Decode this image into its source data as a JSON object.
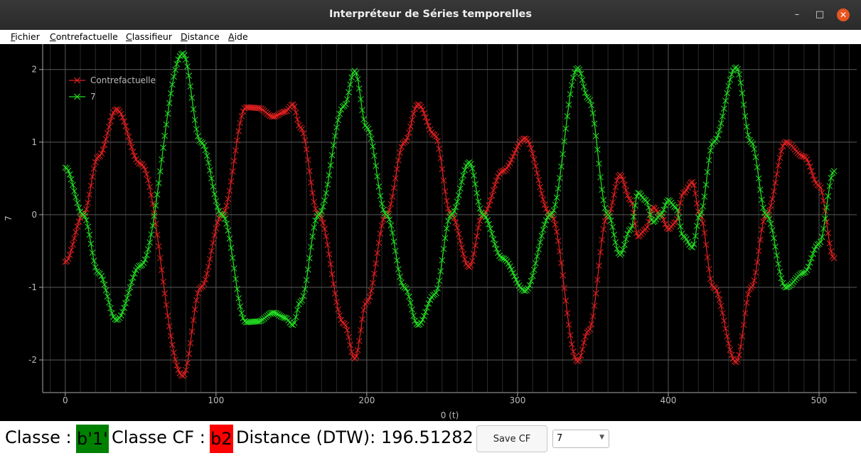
{
  "window": {
    "title": "Interpréteur de Séries temporelles"
  },
  "menu": [
    {
      "first": "F",
      "rest": "ichier"
    },
    {
      "first": "C",
      "rest": "ontrefactuelle"
    },
    {
      "first": "C",
      "rest": "lassifieur"
    },
    {
      "first": "D",
      "rest": "istance"
    },
    {
      "first": "A",
      "rest": "ide"
    }
  ],
  "status": {
    "classe_label": "Classe :",
    "classe_value": "b'1'",
    "classe_color": "#008000",
    "classe_cf_label": "Classe CF :",
    "classe_cf_value": "b2",
    "classe_cf_color": "#ff0000",
    "distance_label": "Distance (DTW):",
    "distance_value": "196.51282",
    "save_label": "Save CF",
    "series_select": "7"
  },
  "chart_data": {
    "type": "line",
    "xlabel": "0 (t)",
    "ylabel": "7",
    "xlim": [
      -15,
      525
    ],
    "ylim": [
      -2.45,
      2.35
    ],
    "x_ticks": [
      0,
      100,
      200,
      300,
      400,
      500
    ],
    "y_ticks": [
      2,
      1,
      0,
      -1,
      -2
    ],
    "y_tick_labels": [
      "2",
      "1",
      "0",
      "-1",
      "-2"
    ],
    "grid": true,
    "legend_position": "top-left",
    "marker": "x",
    "series": [
      {
        "name": "Contrefactuelle",
        "color": "#e02020",
        "points": [
          [
            0,
            -0.65
          ],
          [
            12,
            0
          ],
          [
            22,
            0.8
          ],
          [
            34,
            1.45
          ],
          [
            50,
            0.7
          ],
          [
            78,
            -2.22
          ],
          [
            90,
            -1.0
          ],
          [
            104,
            0
          ],
          [
            120,
            1.48
          ],
          [
            128,
            1.47
          ],
          [
            138,
            1.35
          ],
          [
            146,
            1.42
          ],
          [
            151,
            1.52
          ],
          [
            156,
            1.2
          ],
          [
            168,
            0
          ],
          [
            185,
            -1.5
          ],
          [
            192,
            -1.98
          ],
          [
            200,
            -1.2
          ],
          [
            213,
            0
          ],
          [
            225,
            1.0
          ],
          [
            234,
            1.52
          ],
          [
            245,
            1.1
          ],
          [
            256,
            0
          ],
          [
            268,
            -0.72
          ],
          [
            277,
            0
          ],
          [
            290,
            0.6
          ],
          [
            305,
            1.05
          ],
          [
            322,
            0
          ],
          [
            340,
            -2.02
          ],
          [
            347,
            -1.6
          ],
          [
            360,
            0
          ],
          [
            368,
            0.55
          ],
          [
            375,
            0.2
          ],
          [
            380,
            -0.3
          ],
          [
            385,
            -0.2
          ],
          [
            390,
            0.1
          ],
          [
            395,
            0.0
          ],
          [
            400,
            -0.2
          ],
          [
            405,
            -0.1
          ],
          [
            410,
            0.3
          ],
          [
            416,
            0.45
          ],
          [
            421,
            0.0
          ],
          [
            430,
            -1.0
          ],
          [
            445,
            -2.03
          ],
          [
            455,
            -1.0
          ],
          [
            465,
            0
          ],
          [
            478,
            1.0
          ],
          [
            490,
            0.8
          ],
          [
            500,
            0.4
          ],
          [
            510,
            -0.6
          ]
        ]
      },
      {
        "name": "7",
        "color": "#22dd22",
        "points": [
          [
            0,
            0.65
          ],
          [
            12,
            0
          ],
          [
            22,
            -0.8
          ],
          [
            34,
            -1.45
          ],
          [
            50,
            -0.7
          ],
          [
            78,
            2.22
          ],
          [
            90,
            1.0
          ],
          [
            104,
            0
          ],
          [
            120,
            -1.48
          ],
          [
            128,
            -1.47
          ],
          [
            138,
            -1.35
          ],
          [
            146,
            -1.42
          ],
          [
            151,
            -1.52
          ],
          [
            156,
            -1.2
          ],
          [
            168,
            0
          ],
          [
            185,
            1.5
          ],
          [
            192,
            1.98
          ],
          [
            200,
            1.2
          ],
          [
            213,
            0
          ],
          [
            225,
            -1.0
          ],
          [
            234,
            -1.52
          ],
          [
            245,
            -1.1
          ],
          [
            256,
            0
          ],
          [
            268,
            0.72
          ],
          [
            277,
            0
          ],
          [
            290,
            -0.6
          ],
          [
            305,
            -1.05
          ],
          [
            322,
            0
          ],
          [
            340,
            2.02
          ],
          [
            347,
            1.6
          ],
          [
            360,
            0
          ],
          [
            368,
            -0.55
          ],
          [
            375,
            -0.2
          ],
          [
            380,
            0.3
          ],
          [
            385,
            0.2
          ],
          [
            390,
            -0.1
          ],
          [
            395,
            0.0
          ],
          [
            400,
            0.2
          ],
          [
            405,
            0.1
          ],
          [
            410,
            -0.3
          ],
          [
            416,
            -0.45
          ],
          [
            421,
            0.0
          ],
          [
            430,
            1.0
          ],
          [
            445,
            2.03
          ],
          [
            455,
            1.0
          ],
          [
            465,
            0
          ],
          [
            478,
            -1.0
          ],
          [
            490,
            -0.8
          ],
          [
            500,
            -0.4
          ],
          [
            510,
            0.6
          ]
        ]
      }
    ]
  }
}
